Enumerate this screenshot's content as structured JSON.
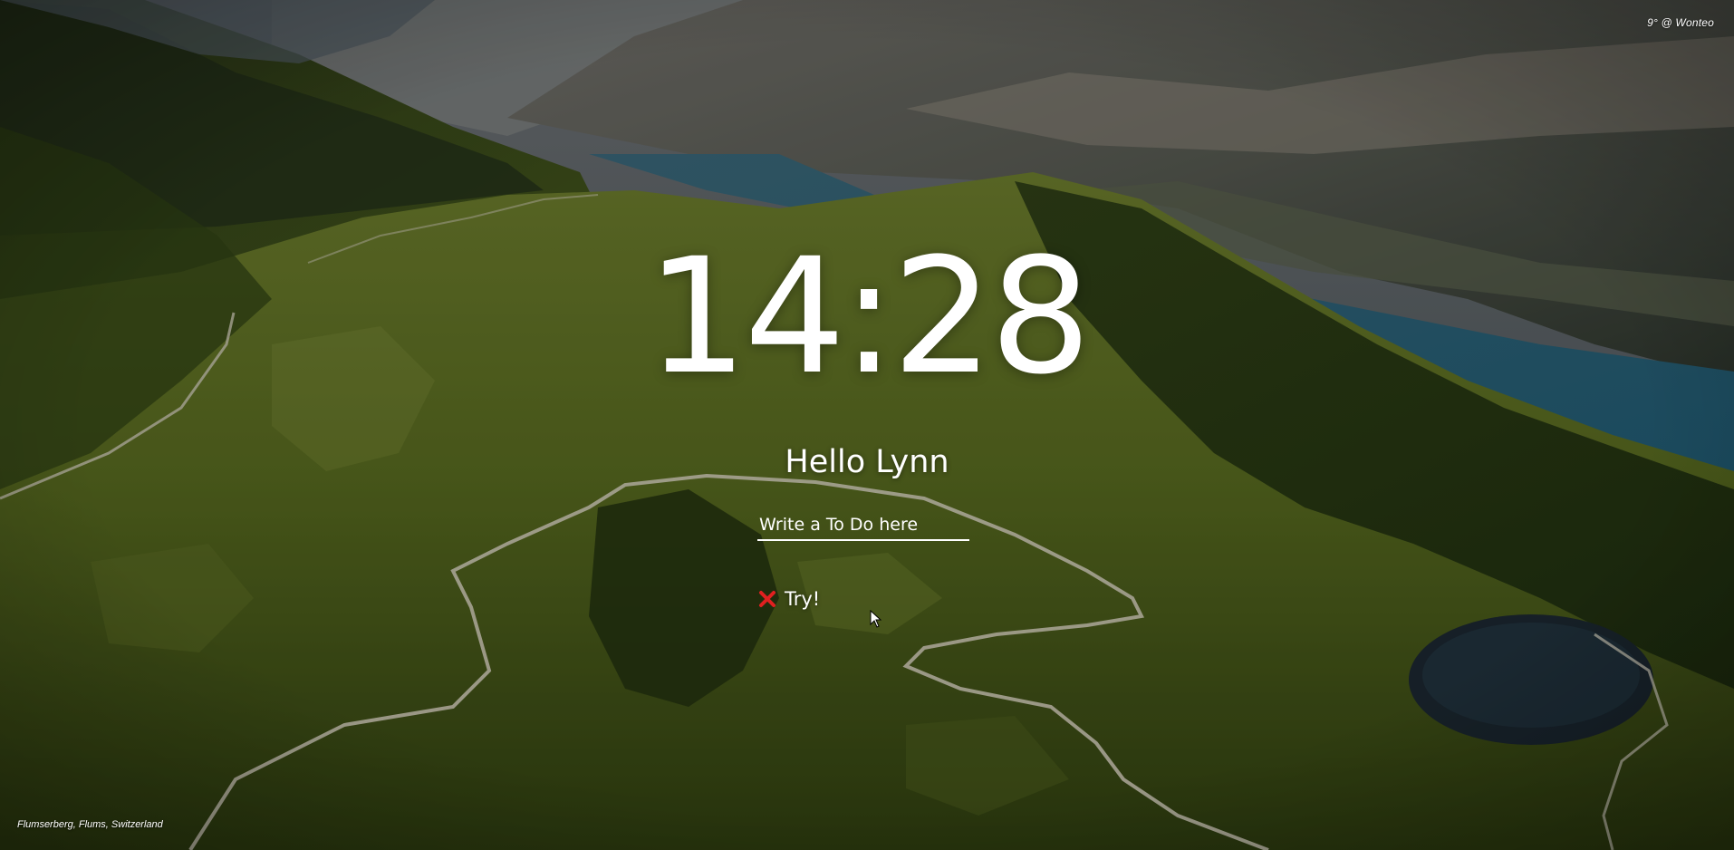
{
  "weather": {
    "text": "9° @ Wonteo"
  },
  "clock": {
    "time": "14:28"
  },
  "greeting": {
    "text": "Hello Lynn"
  },
  "todo": {
    "input_placeholder": "Write a To Do here",
    "input_value": "",
    "items": [
      {
        "label": "Try!",
        "delete_icon": "x-icon",
        "delete_color": "#e02020"
      }
    ]
  },
  "background": {
    "location": "Flumserberg, Flums, Switzerland"
  }
}
